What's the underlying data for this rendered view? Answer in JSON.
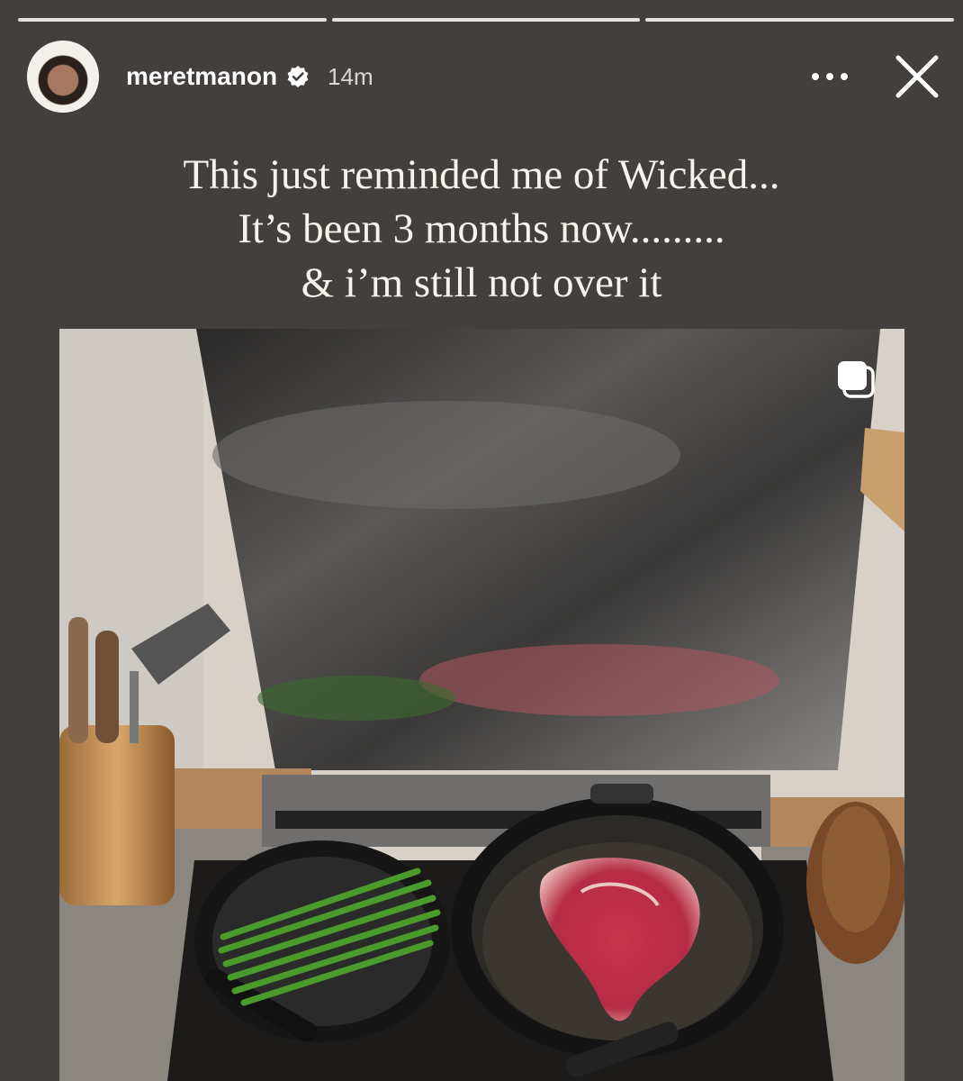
{
  "story": {
    "username": "meretmanon",
    "time": "14m",
    "caption": [
      "This just reminded me of Wicked...",
      "It’s been 3 months now.........",
      "& i’m still not over it"
    ]
  },
  "icons": {
    "verified": "verified-badge-icon",
    "more": "more-options-icon",
    "close": "close-icon",
    "multi": "multi-photo-icon"
  },
  "colors": {
    "background": "#433f3c"
  }
}
